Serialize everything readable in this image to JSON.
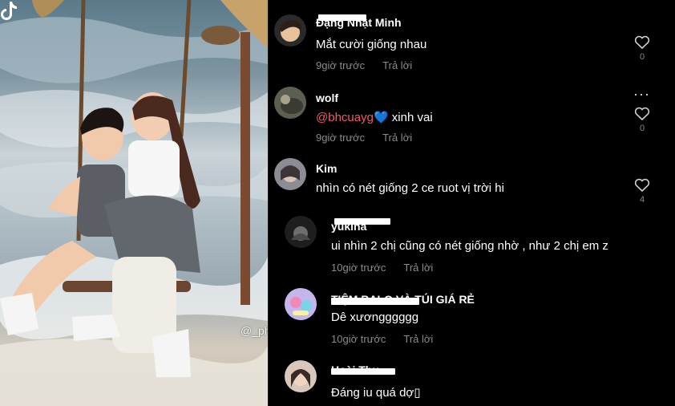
{
  "video": {
    "watermark": "@_ph"
  },
  "comments": [
    {
      "username": "Đặng Nhật Minh",
      "text": "Mắt cười giống nhau",
      "time": "9giờ trước",
      "reply_label": "Trả lời",
      "likes": "0",
      "avatar_color": "#d9b48f"
    },
    {
      "username": "wolf",
      "mention": "@bhcuayg",
      "emoji": "💙",
      "text": " xinh vai",
      "time": "9giờ trước",
      "reply_label": "Trả lời",
      "likes": "0",
      "more_icon": "···",
      "avatar_color": "#6b6f5a"
    },
    {
      "username": "Kim",
      "text": "nhìn có nét giống 2 ce ruot vị trời hi",
      "likes": "4",
      "avatar_color": "#8f8f98"
    },
    {
      "username": "yukina",
      "text": "ui nhìn 2 chị cũng có nét giống nhờ , như 2 chị em z",
      "time": "10giờ trước",
      "reply_label": "Trả lời",
      "avatar_color": "#3b3b3b"
    },
    {
      "username": "TIỆM BALO VÀ TÚI GIÁ RẺ",
      "text": "Dê xươngggggg",
      "time": "10giờ trước",
      "reply_label": "Trả lời",
      "avatar_color": "#b8a8e0"
    },
    {
      "username": "Hoài Thu",
      "text": "Đáng iu quá dợ▯",
      "avatar_color": "#c9a996"
    }
  ],
  "colors": {
    "background": "#000000",
    "mention": "#f25a6b",
    "muted": "#8a8a8a"
  }
}
